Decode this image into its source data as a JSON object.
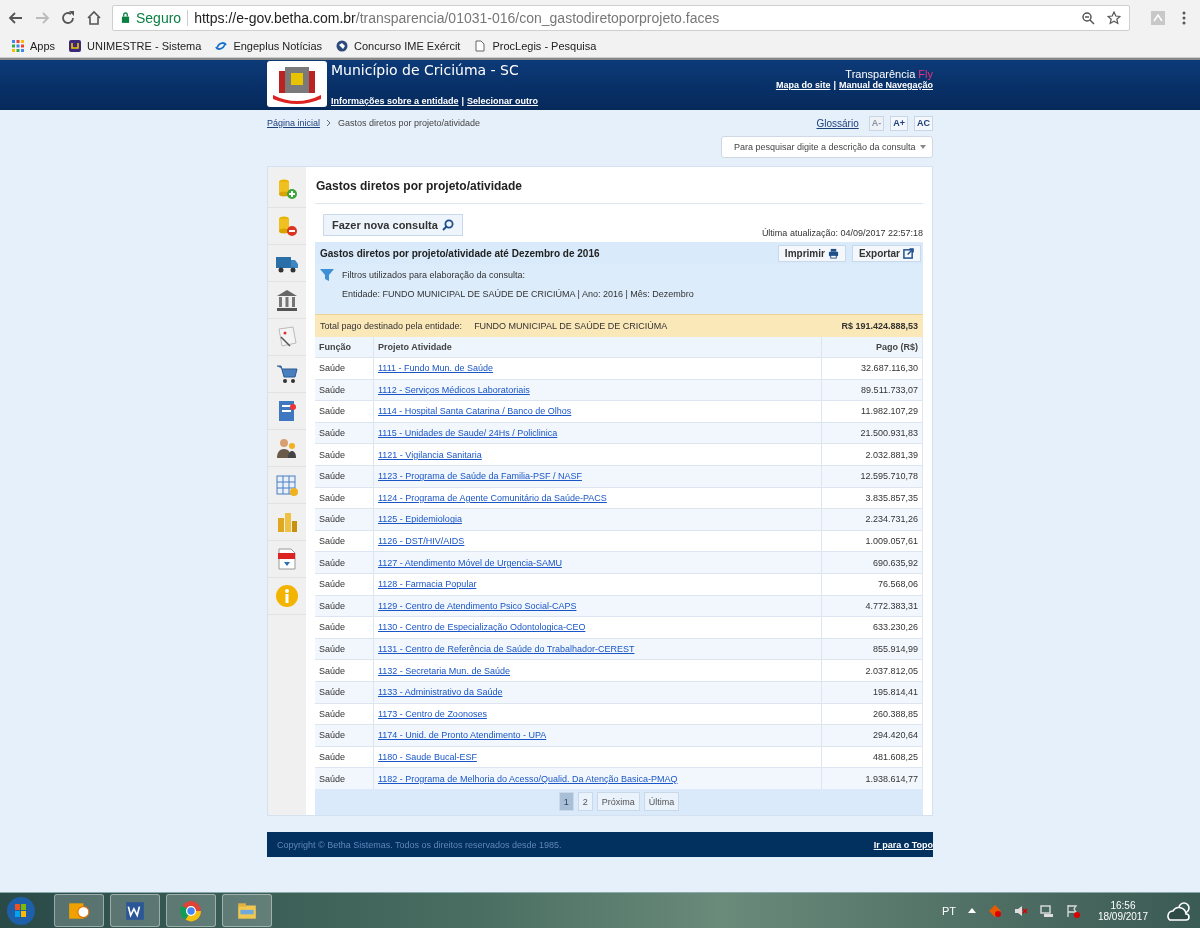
{
  "browser": {
    "security": "Seguro",
    "url_host": "https://e-gov.betha.com.br",
    "url_path": "/transparencia/01031-016/con_gastodiretoporprojeto.faces",
    "bookmarks": [
      {
        "label": "Apps",
        "kind": "apps"
      },
      {
        "label": "UNIMESTRE - Sistema",
        "kind": "unimestre"
      },
      {
        "label": "Engeplus Notícias",
        "kind": "engeplus"
      },
      {
        "label": "Concurso IME Exércit",
        "kind": "globe"
      },
      {
        "label": "ProcLegis - Pesquisa",
        "kind": "page"
      }
    ]
  },
  "header": {
    "title": "Município de Criciúma - SC",
    "separator": "|",
    "right_separator": "|",
    "links": [
      "Informações sobre a entidade",
      "Selecionar outro"
    ],
    "brand": "Transparência",
    "brand_accent": "Fly",
    "right_links": [
      "Mapa do site",
      "Manual de Navegação"
    ]
  },
  "breadcrumb": [
    "Página inicial",
    "Gastos diretos por projeto/atividade"
  ],
  "glossary": "Glossário",
  "font_buttons": [
    {
      "label": "A-",
      "disabled": true
    },
    {
      "label": "A+",
      "disabled": false
    },
    {
      "label": "AC",
      "disabled": false
    }
  ],
  "search": {
    "placeholder": "Para pesquisar digite a descrição da consulta"
  },
  "page_title": "Gastos diretos por projeto/atividade",
  "new_query": "Fazer nova consulta",
  "last_update": "Última atualização: 04/09/2017 22:57:18",
  "report": {
    "title": "Gastos diretos por projeto/atividade até Dezembro de 2016",
    "buttons": [
      {
        "label": "Imprimir",
        "kind": "print"
      },
      {
        "label": "Exportar",
        "kind": "export"
      }
    ],
    "filters_title": "Filtros utilizados para elaboração da consulta:",
    "filters": "Entidade: FUNDO MUNICIPAL DE SAÚDE DE CRICIÚMA | Ano: 2016 | Mês: Dezembro",
    "total_label": "Total pago destinado pela entidade:",
    "total_entity": "FUNDO MUNICIPAL DE SAÚDE DE CRICIÚMA",
    "total_value": "R$ 191.424.888,53"
  },
  "table": {
    "columns": [
      "Função",
      "Projeto Atividade",
      "Pago (R$)"
    ],
    "rows": [
      [
        "Saúde",
        "1111 - Fundo Mun. de Saúde",
        "32.687.116,30"
      ],
      [
        "Saúde",
        "1112 - Serviços Médicos Laboratoriais",
        "89.511.733,07"
      ],
      [
        "Saúde",
        "1114 - Hospital Santa Catarina / Banco de Olhos",
        "11.982.107,29"
      ],
      [
        "Saúde",
        "1115 - Unidades de Saude/ 24Hs / Policlinica",
        "21.500.931,83"
      ],
      [
        "Saúde",
        "1121 - Vigilancia Sanitaria",
        "2.032.881,39"
      ],
      [
        "Saúde",
        "1123 - Programa de Saúde da Familia-PSF / NASF",
        "12.595.710,78"
      ],
      [
        "Saúde",
        "1124 - Programa de Agente Comunitário da Saúde-PACS",
        "3.835.857,35"
      ],
      [
        "Saúde",
        "1125 - Epidemiologia",
        "2.234.731,26"
      ],
      [
        "Saúde",
        "1126 - DST/HIV/AIDS",
        "1.009.057,61"
      ],
      [
        "Saúde",
        "1127 - Atendimento Móvel de Urgencia-SAMU",
        "690.635,92"
      ],
      [
        "Saúde",
        "1128 - Farmacia Popular",
        "76.568,06"
      ],
      [
        "Saúde",
        "1129 - Centro de Atendimento Psico Social-CAPS",
        "4.772.383,31"
      ],
      [
        "Saúde",
        "1130 - Centro de Especialização Odontologica-CEO",
        "633.230,26"
      ],
      [
        "Saúde",
        "1131 - Centro de Referência de Saúde do Trabalhador-CEREST",
        "855.914,99"
      ],
      [
        "Saúde",
        "1132 - Secretaria Mun. de Saúde",
        "2.037.812,05"
      ],
      [
        "Saúde",
        "1133 - Administrativo da Saúde",
        "195.814,41"
      ],
      [
        "Saúde",
        "1173 - Centro de Zoonoses",
        "260.388,85"
      ],
      [
        "Saúde",
        "1174 - Unid. de Pronto Atendimento - UPA",
        "294.420,64"
      ],
      [
        "Saúde",
        "1180 - Saude Bucal-ESF",
        "481.608,25"
      ],
      [
        "Saúde",
        "1182 - Programa de Melhoria do Acesso/Qualid. Da Atenção Basica-PMAQ",
        "1.938.614,77"
      ]
    ]
  },
  "pagination": [
    {
      "label": "1",
      "selected": true
    },
    {
      "label": "2",
      "selected": false
    },
    {
      "label": "Próxima",
      "selected": false
    },
    {
      "label": "Última",
      "selected": false
    }
  ],
  "footer": {
    "copyright": "Copyright © Betha Sistemas. Todos os direitos reservados desde 1985.",
    "top_link": "Ir para o Topo"
  },
  "taskbar": {
    "language": "PT",
    "time": "16:56",
    "date": "18/09/2017"
  }
}
